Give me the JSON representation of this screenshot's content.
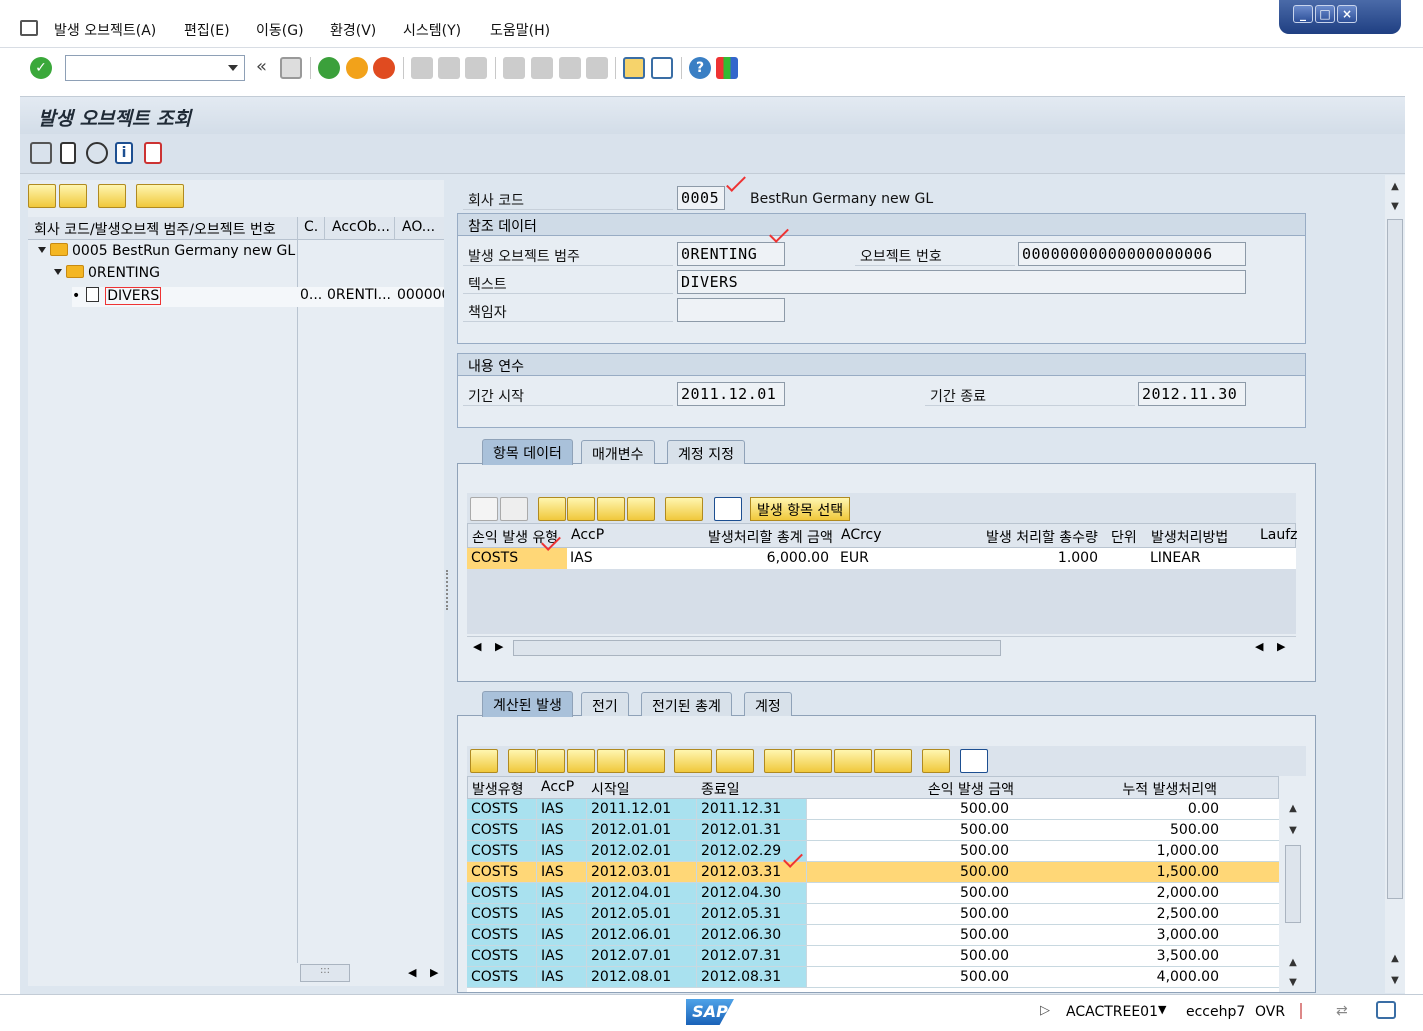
{
  "menu": {
    "items": [
      "발생 오브젝트(A)",
      "편집(E)",
      "이동(G)",
      "환경(V)",
      "시스템(Y)",
      "도움말(H)"
    ]
  },
  "window_controls": [
    "minimize",
    "maximize",
    "close"
  ],
  "toolbar": {
    "command_field": "",
    "history": "«",
    "icons": [
      "check-icon",
      "save-icon",
      "back-icon",
      "exit-icon",
      "cancel-icon",
      "print-icon",
      "find-icon",
      "find-next-icon",
      "first-page-icon",
      "prev-page-icon",
      "next-page-icon",
      "last-page-icon",
      "new-session-icon",
      "shortcut-icon",
      "help-icon",
      "layout-icon"
    ]
  },
  "title": "발생 오브젝트 조회",
  "tree": {
    "headers": [
      "회사 코드/발생오브젝 범주/오브젝트 번호",
      "C.",
      "AccOb...",
      "AO..."
    ],
    "nodes": [
      {
        "label": "0005 BestRun Germany new GL",
        "level": 0
      },
      {
        "label": "0RENTING",
        "level": 1
      },
      {
        "label": "DIVERS",
        "level": 2,
        "c": "0...",
        "accob": "0RENTI...",
        "ao": "000000"
      }
    ]
  },
  "header": {
    "company_code_label": "회사 코드",
    "company_code": "0005",
    "company_name": "BestRun Germany new GL"
  },
  "reference": {
    "title": "참조 데이터",
    "category_label": "발생 오브젝트 범주",
    "category": "0RENTING",
    "object_no_label": "오브젝트 번호",
    "object_no": "00000000000000000006",
    "text_label": "텍스트",
    "text": "DIVERS",
    "responsible_label": "책임자",
    "responsible": ""
  },
  "duration": {
    "title": "내용 연수",
    "start_label": "기간 시작",
    "start": "2011.12.01",
    "end_label": "기간 종료",
    "end": "2012.11.30"
  },
  "tabs1": [
    "항목 데이터",
    "매개변수",
    "계정 지정"
  ],
  "item_grid": {
    "select_button": "발생 항목 선택",
    "headers": [
      "손익 발생 유형",
      "AccP",
      "발생처리할 총계 금액",
      "ACrcy",
      "발생 처리할 총수량",
      "단위",
      "발생처리방법",
      "Laufz"
    ],
    "rows": [
      [
        "COSTS",
        "IAS",
        "6,000.00",
        "EUR",
        "1.000",
        "",
        "LINEAR",
        ""
      ]
    ]
  },
  "tabs2": [
    "계산된 발생",
    "전기",
    "전기된 총계",
    "계정"
  ],
  "calc_grid": {
    "headers": [
      "발생유형",
      "AccP",
      "시작일",
      "종료일",
      "손익 발생 금액",
      "누적 발생처리액"
    ],
    "rows": [
      [
        "COSTS",
        "IAS",
        "2011.12.01",
        "2011.12.31",
        "500.00",
        "0.00"
      ],
      [
        "COSTS",
        "IAS",
        "2012.01.01",
        "2012.01.31",
        "500.00",
        "500.00"
      ],
      [
        "COSTS",
        "IAS",
        "2012.02.01",
        "2012.02.29",
        "500.00",
        "1,000.00"
      ],
      [
        "COSTS",
        "IAS",
        "2012.03.01",
        "2012.03.31",
        "500.00",
        "1,500.00"
      ],
      [
        "COSTS",
        "IAS",
        "2012.04.01",
        "2012.04.30",
        "500.00",
        "2,000.00"
      ],
      [
        "COSTS",
        "IAS",
        "2012.05.01",
        "2012.05.31",
        "500.00",
        "2,500.00"
      ],
      [
        "COSTS",
        "IAS",
        "2012.06.01",
        "2012.06.30",
        "500.00",
        "3,000.00"
      ],
      [
        "COSTS",
        "IAS",
        "2012.07.01",
        "2012.07.31",
        "500.00",
        "3,500.00"
      ],
      [
        "COSTS",
        "IAS",
        "2012.08.01",
        "2012.08.31",
        "500.00",
        "4,000.00"
      ]
    ],
    "selected_row": 3
  },
  "status": {
    "logo": "SAP",
    "program": "ACACTREE01",
    "system": "eccehp7",
    "mode": "OVR"
  }
}
